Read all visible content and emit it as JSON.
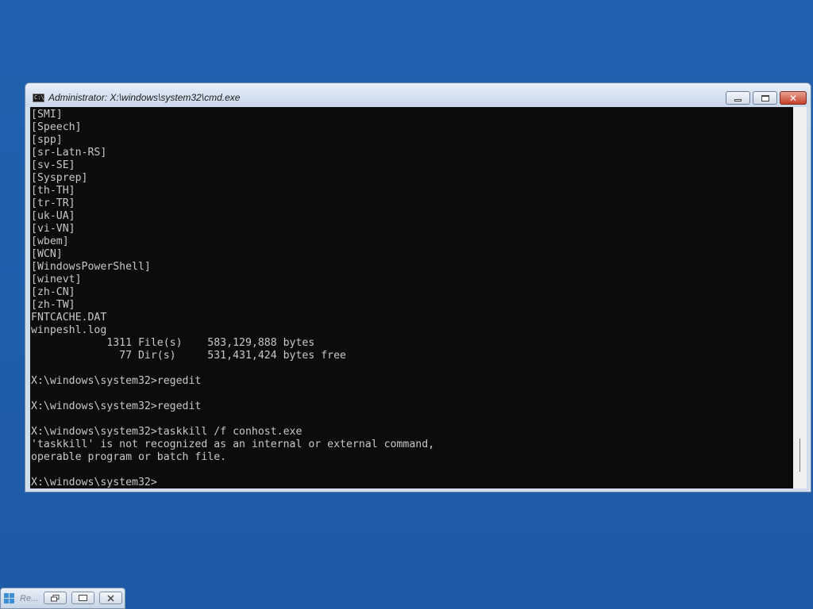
{
  "window": {
    "title": "Administrator: X:\\windows\\system32\\cmd.exe",
    "buttons": {
      "minimize": "minimize",
      "maximize": "maximize",
      "close": "✕"
    }
  },
  "console": {
    "lines": [
      "[SMI]",
      "[Speech]",
      "[spp]",
      "[sr-Latn-RS]",
      "[sv-SE]",
      "[Sysprep]",
      "[th-TH]",
      "[tr-TR]",
      "[uk-UA]",
      "[vi-VN]",
      "[wbem]",
      "[WCN]",
      "[WindowsPowerShell]",
      "[winevt]",
      "[zh-CN]",
      "[zh-TW]",
      "FNTCACHE.DAT",
      "winpeshl.log",
      "            1311 File(s)    583,129,888 bytes",
      "              77 Dir(s)     531,431,424 bytes free",
      "",
      "X:\\windows\\system32>regedit",
      "",
      "X:\\windows\\system32>regedit",
      "",
      "X:\\windows\\system32>taskkill /f conhost.exe",
      "'taskkill' is not recognized as an internal or external command,",
      "operable program or batch file.",
      "",
      "X:\\windows\\system32>"
    ]
  },
  "taskbar": {
    "item_label": "Re...",
    "icon": "windows-setup-icon"
  }
}
